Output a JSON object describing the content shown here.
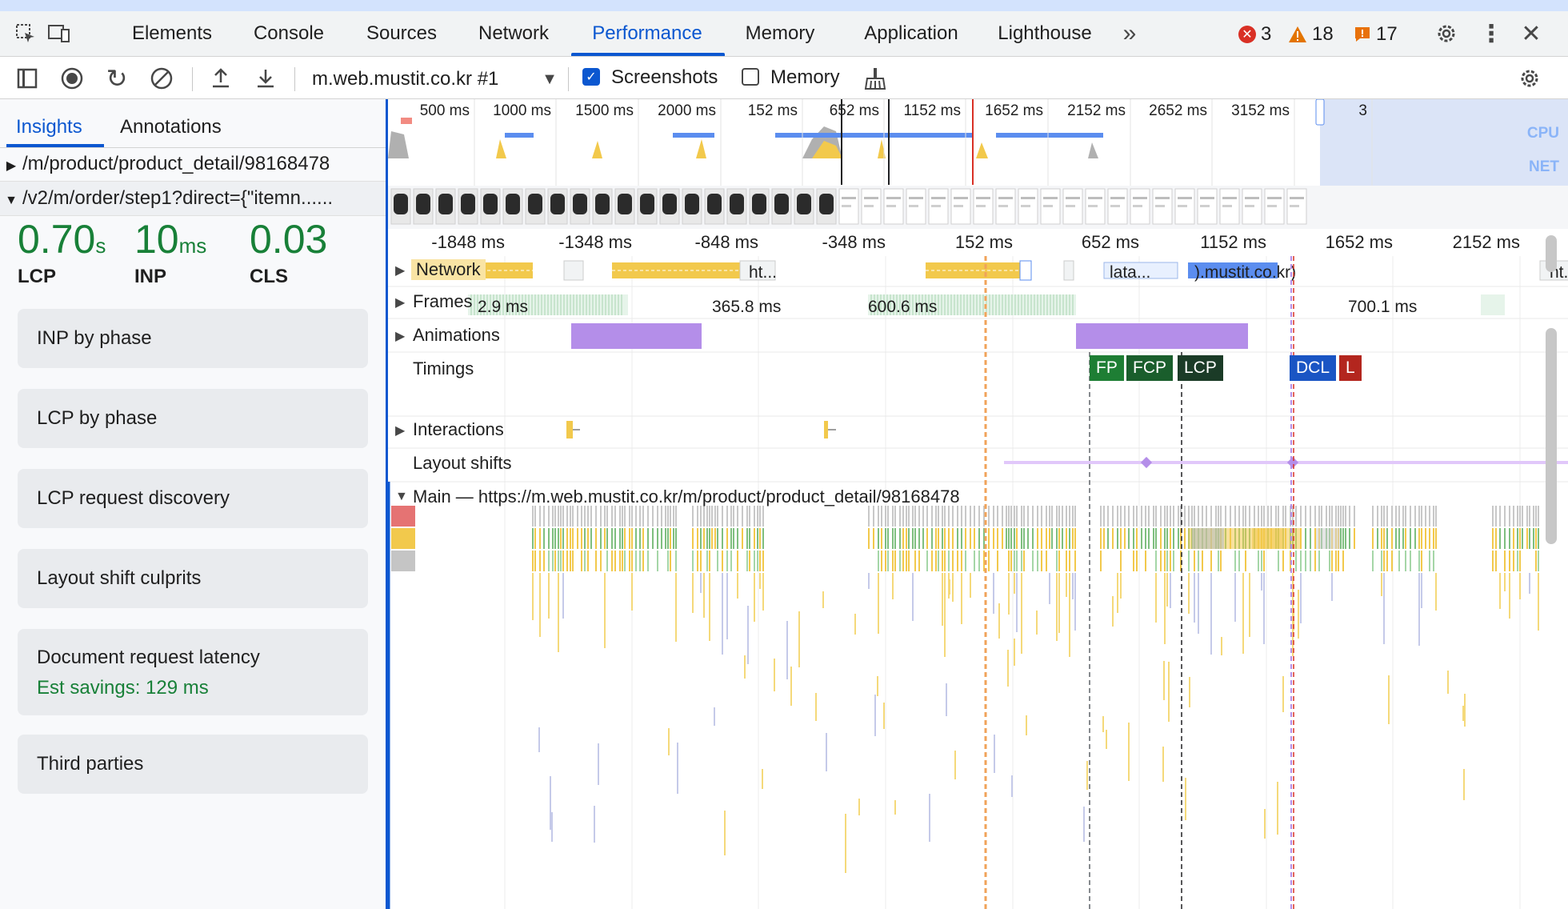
{
  "devtools": {
    "tabs": [
      "Elements",
      "Console",
      "Sources",
      "Network",
      "Performance",
      "Memory",
      "Application",
      "Lighthouse"
    ],
    "active_tab": "Performance",
    "badges": {
      "errors": "3",
      "warnings": "18",
      "issues": "17"
    },
    "icons": [
      "inspect-element-icon",
      "device-toolbar-icon",
      "more-tabs-icon",
      "settings-gear-icon",
      "kebab-menu-icon",
      "close-icon"
    ]
  },
  "toolbar": {
    "recording_select": "m.web.mustit.co.kr #1",
    "screenshots_label": "Screenshots",
    "screenshots_checked": true,
    "memory_label": "Memory",
    "memory_checked": false
  },
  "sidebar": {
    "tabs": [
      "Insights",
      "Annotations"
    ],
    "active_tab": "Insights",
    "crumbs": [
      "/m/product/product_detail/98168478",
      "/v2/m/order/step1?direct={\"itemn......"
    ],
    "metrics": [
      {
        "value": "0.70",
        "unit": "s",
        "label": "LCP"
      },
      {
        "value": "10",
        "unit": "ms",
        "label": "INP"
      },
      {
        "value": "0.03",
        "unit": "",
        "label": "CLS"
      }
    ],
    "insights": [
      {
        "title": "INP by phase"
      },
      {
        "title": "LCP by phase"
      },
      {
        "title": "LCP request discovery"
      },
      {
        "title": "Layout shift culprits"
      },
      {
        "title": "Document request latency",
        "savings": "Est savings: 129 ms"
      },
      {
        "title": "Third parties"
      }
    ]
  },
  "overview": {
    "ticks": [
      "500 ms",
      "1000 ms",
      "1500 ms",
      "2000 ms",
      "152 ms",
      "652 ms",
      "1152 ms",
      "1652 ms",
      "2152 ms",
      "2652 ms",
      "3152 ms",
      "3"
    ],
    "cpu_label": "CPU",
    "net_label": "NET"
  },
  "ruler": {
    "ticks": [
      "-1848 ms",
      "-1348 ms",
      "-848 ms",
      "-348 ms",
      "152 ms",
      "652 ms",
      "1152 ms",
      "1652 ms",
      "2152 ms"
    ]
  },
  "tracks": {
    "network_label": "Network",
    "network_segments": [
      "ht...",
      "lata...",
      ").mustit.co.kr)",
      "ht..."
    ],
    "frames_label": "Frames",
    "frame_durations": [
      "2.9 ms",
      "365.8 ms",
      "600.6 ms",
      "700.1 ms"
    ],
    "animations_label": "Animations",
    "timings_label": "Timings",
    "timing_markers": [
      "FP",
      "FCP",
      "LCP",
      "DCL",
      "L"
    ],
    "interactions_label": "Interactions",
    "layout_shifts_label": "Layout shifts",
    "main_label": "Main — https://m.web.mustit.co.kr/m/product/product_detail/98168478"
  },
  "colors": {
    "accent": "#0b57d0",
    "good_metric": "#188038",
    "scripting": "#f2c94c",
    "rendering": "#b48ee9",
    "painting": "#7fbf7f",
    "fp": "#1e7e34",
    "fcp": "#1a5e2c",
    "lcp": "#1b3b27",
    "dcl": "#1a55c4",
    "load": "#b3261e"
  }
}
